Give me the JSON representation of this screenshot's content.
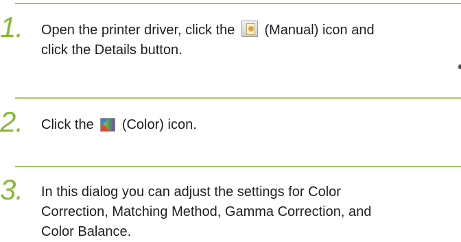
{
  "steps": [
    {
      "number": "1.",
      "line1_before": "Open the printer driver, click the",
      "icon": "manual-icon",
      "line1_after": "(Manual) icon and",
      "line2": "click the Details button."
    },
    {
      "number": "2.",
      "line1_before": "Click the",
      "icon": "color-icon",
      "line1_after": "(Color) icon."
    },
    {
      "number": "3.",
      "line1": "In this dialog you can adjust the settings for Color",
      "line2": "Correction, Matching Method, Gamma Correction, and",
      "line3": "Color Balance."
    }
  ],
  "colors": {
    "accent": "#8ab832",
    "rule": "#a6c75a",
    "text": "#1e1e1e"
  }
}
